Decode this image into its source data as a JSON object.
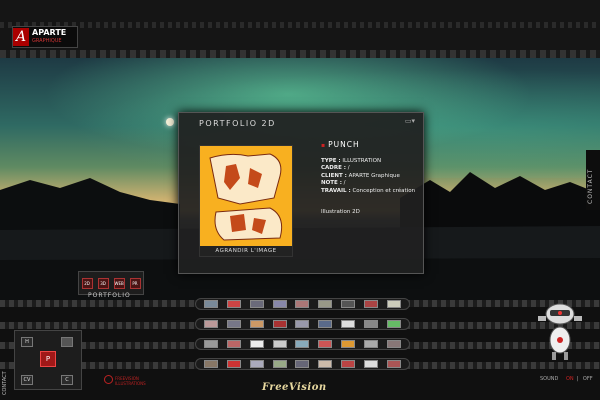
{
  "logo": {
    "name": "APARTE",
    "sub": "GRAPHIQUE",
    "mark": "A"
  },
  "side": {
    "contact_label": "CONTACT",
    "left_label": "CONTACT"
  },
  "portfolio": {
    "title": "PORTFOLIO 2D",
    "enlarge_label": "AGRANDIR L'IMAGE",
    "project": {
      "name": "PUNCH",
      "fields": [
        {
          "label": "TYPE :",
          "value": "ILLUSTRATION"
        },
        {
          "label": "CADRE :",
          "value": "/"
        },
        {
          "label": "CLIENT :",
          "value": "APARTE Graphique"
        },
        {
          "label": "NOTE :",
          "value": "/"
        },
        {
          "label": "TRAVAIL :",
          "value": "Conception et création"
        }
      ],
      "category": "Illustration 2D"
    }
  },
  "category_menu": {
    "label": "PORTFOLIO",
    "items": [
      "2D",
      "3D",
      "WEB",
      "PR"
    ]
  },
  "nav_pad": {
    "keys": [
      "H",
      "P",
      "CV",
      "C"
    ]
  },
  "footer": {
    "brand": "FreeVision",
    "credit_line1": "FREEVISION",
    "credit_line2": "ILLUSTRATIONS",
    "sound_label": "SOUND",
    "sound_on": "ON",
    "sound_off": "OFF"
  },
  "colors": {
    "accent": "#c22222",
    "panel": "#202020",
    "preview_bg": "#f8b020"
  }
}
